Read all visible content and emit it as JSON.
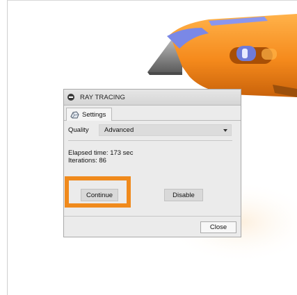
{
  "dialog": {
    "title": "RAY TRACING",
    "tab_label": "Settings",
    "quality_label": "Quality",
    "quality_value": "Advanced",
    "elapsed_text": "Elapsed time: 173 sec",
    "iterations_text": "Iterations: 86",
    "continue_label": "Continue",
    "disable_label": "Disable",
    "close_label": "Close"
  },
  "icons": [
    "collapse-icon",
    "settings-icon",
    "chevron-down-icon"
  ],
  "colors": {
    "highlight": "#f08a1c",
    "knife_orange": "#f58a1c",
    "knife_blue": "#7a88e6",
    "blade": "#8e8e8e"
  }
}
